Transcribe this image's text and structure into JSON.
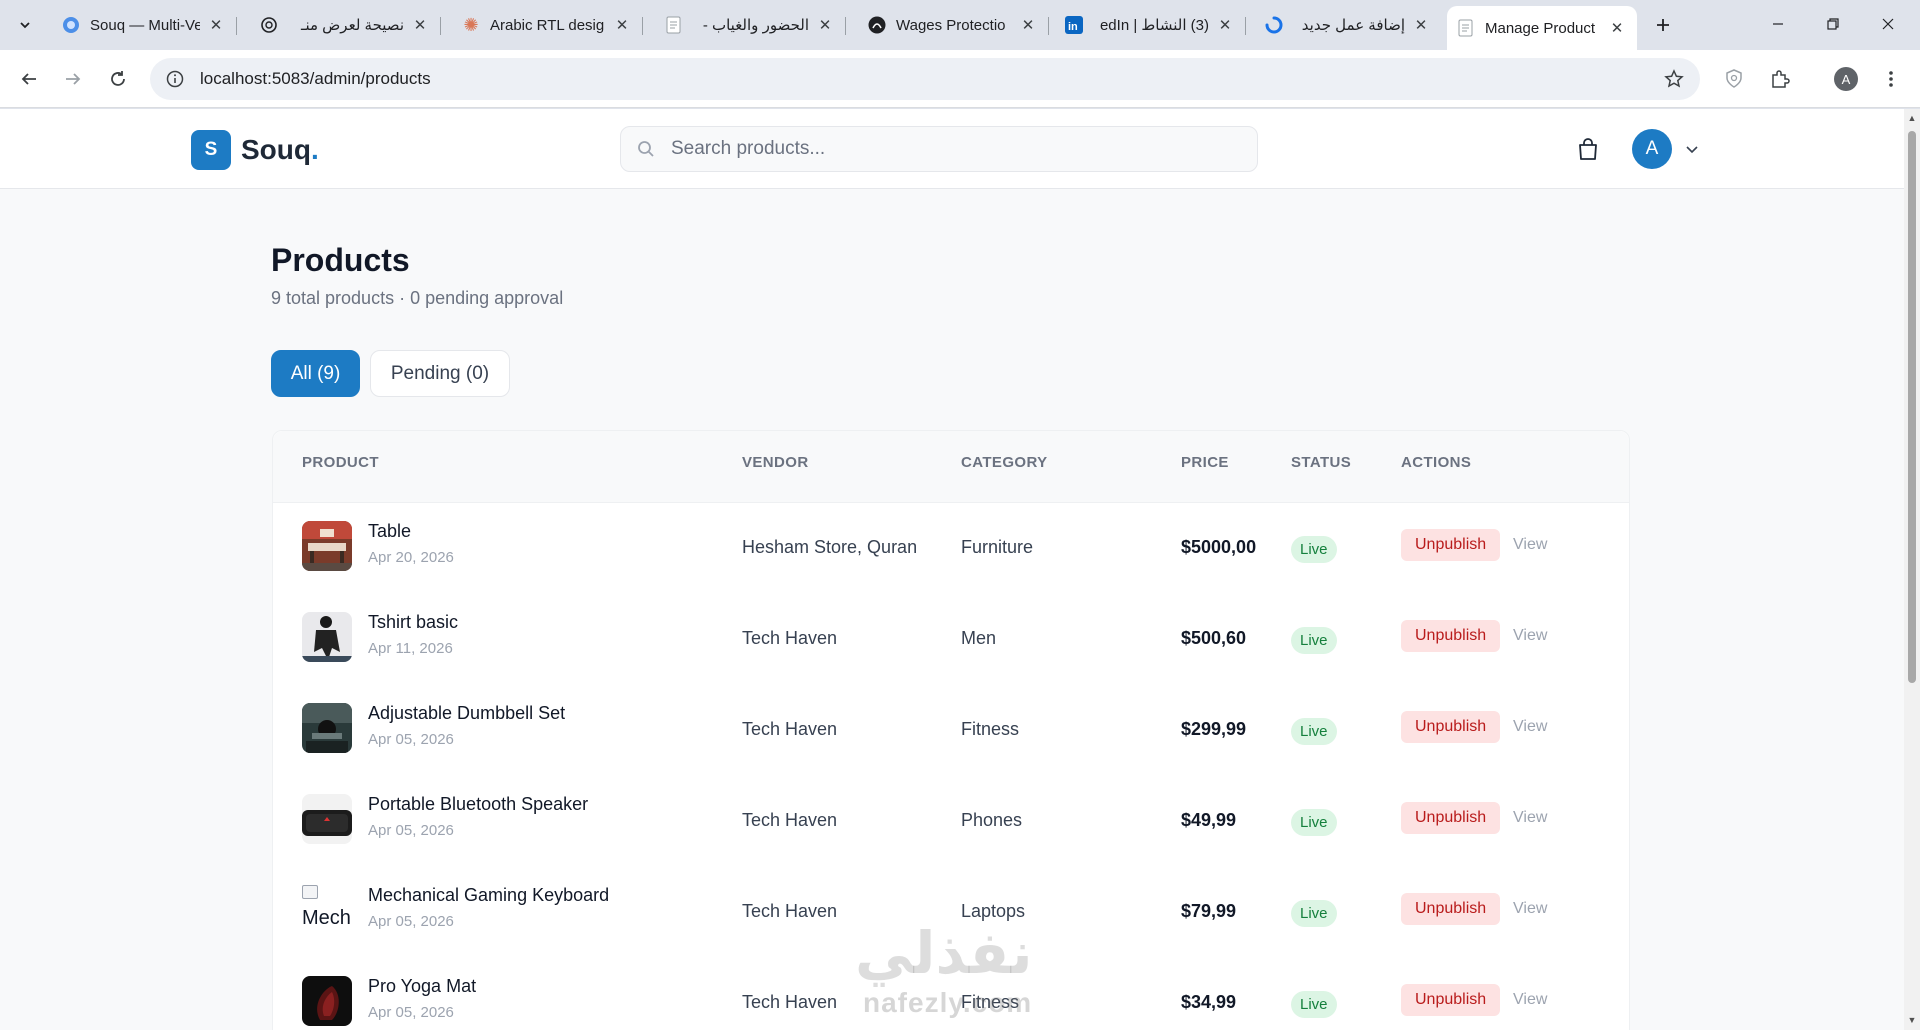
{
  "browser": {
    "tabs": [
      {
        "title": "Souq — Multi-Ve",
        "icon": "circle-icon",
        "active": false
      },
      {
        "title": "نصيحة لعرض منـ",
        "icon": "openai-icon",
        "active": false
      },
      {
        "title": "Arabic RTL desig",
        "icon": "claude-icon",
        "active": false
      },
      {
        "title": "الحضور والغياب -",
        "icon": "doc-icon",
        "active": false
      },
      {
        "title": "Wages Protectio",
        "icon": "github-icon",
        "active": false
      },
      {
        "title": "(3) النشاط | edIn",
        "icon": "linkedin-icon",
        "active": false
      },
      {
        "title": "إضافة عمل جديد",
        "icon": "spinner-icon",
        "active": false
      },
      {
        "title": "Manage Product",
        "icon": "doc-icon",
        "active": true
      }
    ],
    "url": "localhost:5083/admin/products",
    "profile_initial": "A"
  },
  "header": {
    "logo_mark": "S",
    "logo_text": "Souq",
    "logo_dot": ".",
    "search_placeholder": "Search products...",
    "user_initial": "A",
    "brand_color": "#1d7bc4"
  },
  "page": {
    "title": "Products",
    "subtitle": "9 total products · 0 pending approval",
    "filters": {
      "all": "All (9)",
      "pending": "Pending (0)"
    }
  },
  "table": {
    "columns": {
      "product": "PRODUCT",
      "vendor": "VENDOR",
      "category": "CATEGORY",
      "price": "PRICE",
      "status": "STATUS",
      "actions": "ACTIONS"
    },
    "unpublish_label": "Unpublish",
    "view_label": "View",
    "rows": [
      {
        "name": "Table",
        "date": "Apr 20, 2026",
        "vendor": "Hesham Store, Quran",
        "category": "Furniture",
        "price": "$5000,00",
        "status": "Live"
      },
      {
        "name": "Tshirt basic",
        "date": "Apr 11, 2026",
        "vendor": "Tech Haven",
        "category": "Men",
        "price": "$500,60",
        "status": "Live"
      },
      {
        "name": "Adjustable Dumbbell Set",
        "date": "Apr 05, 2026",
        "vendor": "Tech Haven",
        "category": "Fitness",
        "price": "$299,99",
        "status": "Live"
      },
      {
        "name": "Portable Bluetooth Speaker",
        "date": "Apr 05, 2026",
        "vendor": "Tech Haven",
        "category": "Phones",
        "price": "$49,99",
        "status": "Live"
      },
      {
        "name": "Mechanical Gaming Keyboard",
        "date": "Apr 05, 2026",
        "vendor": "Tech Haven",
        "category": "Laptops",
        "price": "$79,99",
        "status": "Live",
        "image_alt": "Mech"
      },
      {
        "name": "Pro Yoga Mat",
        "date": "Apr 05, 2026",
        "vendor": "Tech Haven",
        "category": "Fitness",
        "price": "$34,99",
        "status": "Live"
      }
    ]
  },
  "watermark": {
    "arabic": "نفذلي",
    "latin": "nafezly.com"
  }
}
